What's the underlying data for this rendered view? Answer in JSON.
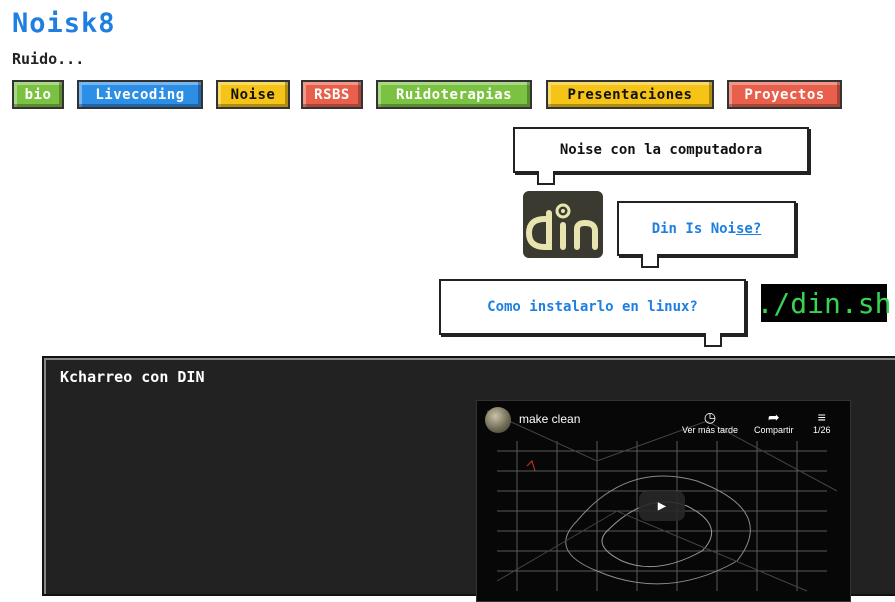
{
  "site": {
    "title": "Noisk8",
    "tagline": "Ruido..."
  },
  "nav": [
    {
      "label": "bio",
      "color": "green"
    },
    {
      "label": "Livecoding",
      "color": "blue"
    },
    {
      "label": "Noise",
      "color": "yellow"
    },
    {
      "label": "RSBS",
      "color": "red"
    },
    {
      "label": "Ruidoterapias",
      "color": "green"
    },
    {
      "label": "Presentaciones",
      "color": "yellow"
    },
    {
      "label": "Proyectos",
      "color": "red"
    }
  ],
  "bubbles": {
    "noise": "Noise con la computadora",
    "din_a": "Din Is Noi",
    "din_b": "se?",
    "install": "Como instalarlo en linux?"
  },
  "din_logo_text": "din",
  "din_sh": "./din.sh",
  "panel": {
    "title": "Kcharreo con DIN",
    "video": {
      "title": "make clean",
      "watch_later": "Ver más tarde",
      "share": "Compartir",
      "playlist": "1/26"
    }
  },
  "colors": {
    "accent": "#1e7fe0",
    "green": "#7cc242",
    "blue": "#2d8ee6",
    "yellow": "#f5c416",
    "red": "#e8604c"
  }
}
